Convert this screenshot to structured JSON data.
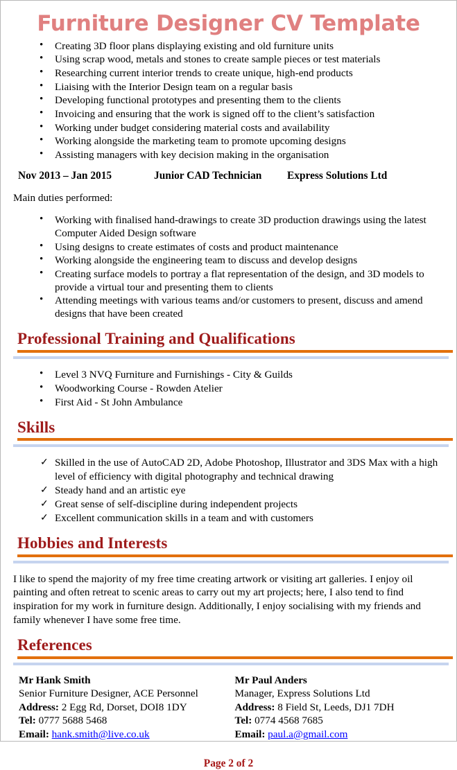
{
  "document": {
    "title": "Furniture Designer CV Template",
    "title_color": "#e08080",
    "heading_color": "#9e1b1b",
    "rule_orange_color": "#e2700d",
    "rule_blue_color": "#c6d4ef",
    "link_color": "#0000ff",
    "footer_color": "#a61717"
  },
  "top_duties": {
    "items": [
      "Creating 3D floor plans displaying existing and old furniture units",
      "Using scrap wood, metals and stones to create sample pieces or test materials",
      "Researching current interior trends to create unique, high-end products",
      "Liaising with the Interior Design team on a regular basis",
      "Developing functional prototypes and presenting them to the clients",
      "Invoicing and ensuring that the work is signed off to the client’s satisfaction",
      "Working under budget considering material costs and availability",
      "Working alongside the marketing team to promote upcoming designs",
      "Assisting managers with key decision making in the organisation"
    ]
  },
  "job": {
    "dates": "Nov 2013 – Jan 2015",
    "job_title": "Junior CAD Technician",
    "company": "Express Solutions Ltd",
    "lead_in": "Main duties performed:",
    "duties": [
      "Working with finalised hand-drawings to create 3D production drawings using the latest Computer Aided Design software",
      "Using designs to create estimates of costs and product maintenance",
      "Working alongside the engineering team to discuss and develop designs",
      "Creating surface models to portray a flat representation of the design, and 3D models to provide a virtual tour and presenting them to clients",
      "Attending meetings with various teams and/or customers to present, discuss and amend designs that have been created"
    ]
  },
  "training": {
    "heading": "Professional Training and Qualifications",
    "items": [
      "Level 3 NVQ Furniture and Furnishings - City & Guilds",
      "Woodworking Course - Rowden Atelier",
      "First Aid - St John Ambulance"
    ]
  },
  "skills": {
    "heading": "Skills",
    "items": [
      "Skilled in the use of AutoCAD 2D, Adobe Photoshop, Illustrator and 3DS Max with a high level of efficiency with digital photography and technical drawing",
      "Steady hand and an artistic eye",
      "Great sense of self-discipline during independent projects",
      "Excellent communication skills in a team and with customers"
    ]
  },
  "hobbies": {
    "heading": "Hobbies and Interests",
    "paragraph": "I like to spend the majority of my free time creating artwork or visiting art galleries. I enjoy oil painting and often retreat to scenic areas to carry out my art projects; here, I also tend to find inspiration for my work in furniture design. Additionally, I enjoy socialising with my friends and family whenever I have some free time."
  },
  "references": {
    "heading": "References",
    "label_address": "Address:",
    "label_tel": "Tel:",
    "label_email": "Email:",
    "entries": [
      {
        "name": "Mr Hank Smith",
        "role": "Senior Furniture Designer, ACE Personnel",
        "address": "2 Egg Rd, Dorset, DOI8 1DY",
        "tel": "0777 5688 5468",
        "email": "hank.smith@live.co.uk"
      },
      {
        "name": "Mr Paul Anders",
        "role": "Manager, Express Solutions Ltd",
        "address": "8 Field St, Leeds, DJ1 7DH",
        "tel": "0774 4568 7685",
        "email": "paul.a@gmail.com"
      }
    ]
  },
  "footer": {
    "page_label": "Page 2 of 2"
  }
}
